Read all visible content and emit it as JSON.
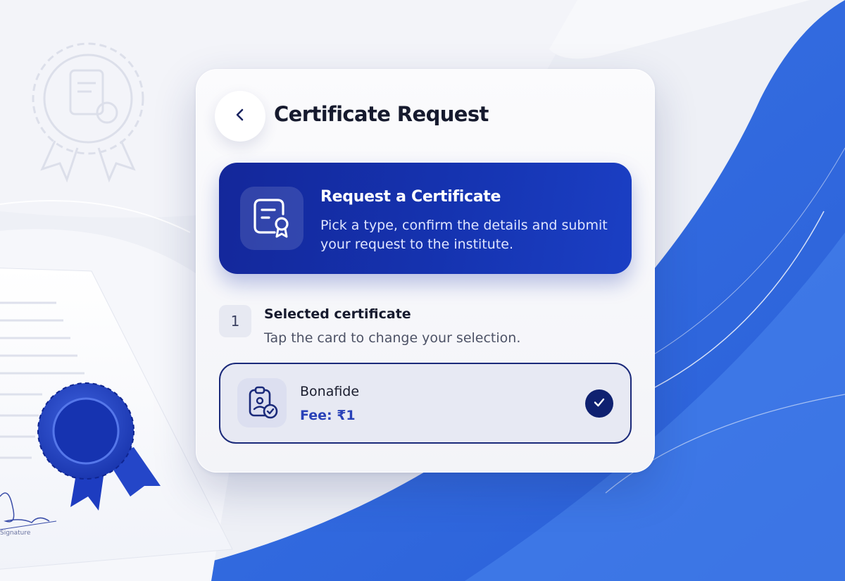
{
  "header": {
    "title": "Certificate Request",
    "back_icon": "chevron-left-icon"
  },
  "hero": {
    "icon": "certificate-document-icon",
    "title": "Request a Certificate",
    "description": "Pick a type, confirm the details and submit your request to the institute."
  },
  "step": {
    "number": "1",
    "title": "Selected certificate",
    "subtitle": "Tap the card to change your selection."
  },
  "selected_certificate": {
    "icon": "clipboard-user-check-icon",
    "name": "Bonafide",
    "fee": "Fee: ₹1",
    "selected": true,
    "check_icon": "checkmark-icon"
  },
  "background": {
    "signature_caption": "Signature"
  },
  "colors": {
    "primary": "#1533b0",
    "primary_dark": "#0f2170",
    "accent_blue": "#3f7de8",
    "page_bg": "#eef0f6"
  }
}
